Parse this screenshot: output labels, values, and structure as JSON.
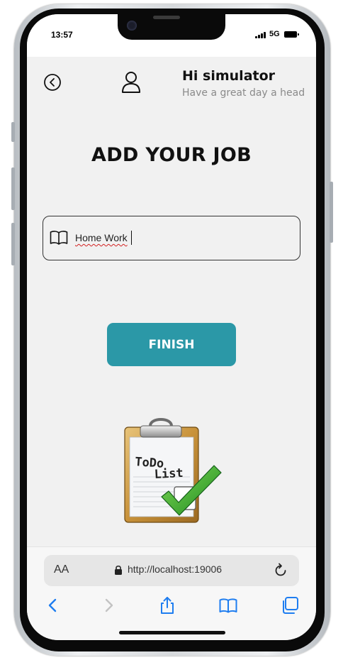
{
  "status_bar": {
    "time": "13:57",
    "network": "5G"
  },
  "header": {
    "greeting_title": "Hi simulator",
    "greeting_subtitle": "Have a great day a head"
  },
  "page": {
    "title": "ADD YOUR JOB"
  },
  "job_input": {
    "value": "Home Work"
  },
  "finish_button": {
    "label": "FINISH"
  },
  "illustration": {
    "line1": "ToDo",
    "line2": "List"
  },
  "browser": {
    "text_size_label": "AA",
    "url": "http://localhost:19006"
  },
  "colors": {
    "accent": "#2b98a7",
    "background": "#f1f1f1",
    "browser_blue": "#1e7df0"
  },
  "icons": {
    "back": "circle-chevron-left-icon",
    "user": "person-outline-icon",
    "input": "open-book-icon",
    "lock": "lock-icon",
    "reload": "reload-icon",
    "toolbar": [
      "back-arrow-icon",
      "forward-arrow-icon",
      "share-icon",
      "bookmarks-icon",
      "tabs-icon"
    ]
  }
}
